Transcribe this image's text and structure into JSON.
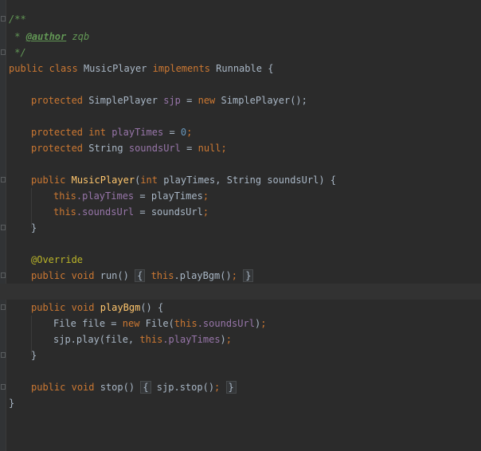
{
  "editor": {
    "language": "java",
    "colors": {
      "background": "#2b2b2b",
      "gutter": "#313335",
      "default_text": "#a9b7c6",
      "keyword": "#cc7832",
      "method": "#ffc66d",
      "field": "#9876aa",
      "number": "#6897bb",
      "comment": "#629755",
      "annotation": "#bbb529"
    },
    "lines": {
      "l1": {
        "comment_open": "/**"
      },
      "l2": {
        "star": " * ",
        "tag": "@author",
        "author": " zqb"
      },
      "l3": {
        "comment_close": " */"
      },
      "l4": {
        "kw_public": "public",
        "kw_class": "class",
        "class_name": "MusicPlayer",
        "kw_implements": "implements",
        "interface": "Runnable",
        "brace": "{"
      },
      "l6": {
        "kw_protected": "protected",
        "type": "SimplePlayer",
        "field": "sjp",
        "eq": "=",
        "kw_new": "new",
        "ctor": "SimplePlayer();"
      },
      "l8": {
        "kw_protected": "protected",
        "kw_int": "int",
        "field": "playTimes",
        "eq": "=",
        "value": "0",
        "semi": ";"
      },
      "l9": {
        "kw_protected": "protected",
        "type": "String",
        "field": "soundsUrl",
        "eq": "=",
        "kw_null": "null",
        "semi": ";"
      },
      "l11": {
        "kw_public": "public",
        "method": "MusicPlayer",
        "paren_open": "(",
        "kw_int": "int",
        "param1": "playTimes,",
        "param_type": "String",
        "param2": "soundsUrl)",
        "brace": "{"
      },
      "l12": {
        "kw_this": "this",
        "field": ".playTimes",
        "rest": " = playTimes",
        "semi": ";"
      },
      "l13": {
        "kw_this": "this",
        "field": ".soundsUrl",
        "rest": " = soundsUrl",
        "semi": ";"
      },
      "l14": {
        "brace": "}"
      },
      "l16": {
        "annotation": "@Override"
      },
      "l17": {
        "kw_public": "public",
        "kw_void": "void",
        "method": "run()",
        "fold_open": "{",
        "kw_this": "this",
        "call": ".playBgm()",
        "semi": ";",
        "fold_close": "}"
      },
      "l19": {
        "kw_public": "public",
        "kw_void": "void",
        "method": "playBgm",
        "parens": "()",
        "brace": "{"
      },
      "l20": {
        "type": "File",
        "var": "file",
        "eq": "=",
        "kw_new": "new",
        "ctor": "File(",
        "kw_this": "this",
        "field": ".soundsUrl",
        "close": ")",
        "semi": ";"
      },
      "l21": {
        "call": "sjp.play(file,",
        "kw_this": "this",
        "field": ".playTimes",
        "close": ")",
        "semi": ";"
      },
      "l22": {
        "brace": "}"
      },
      "l24": {
        "kw_public": "public",
        "kw_void": "void",
        "method": "stop()",
        "fold_open": "{",
        "call": "sjp.stop()",
        "semi": ";",
        "fold_close": "}"
      },
      "l25": {
        "brace": "}"
      }
    }
  }
}
